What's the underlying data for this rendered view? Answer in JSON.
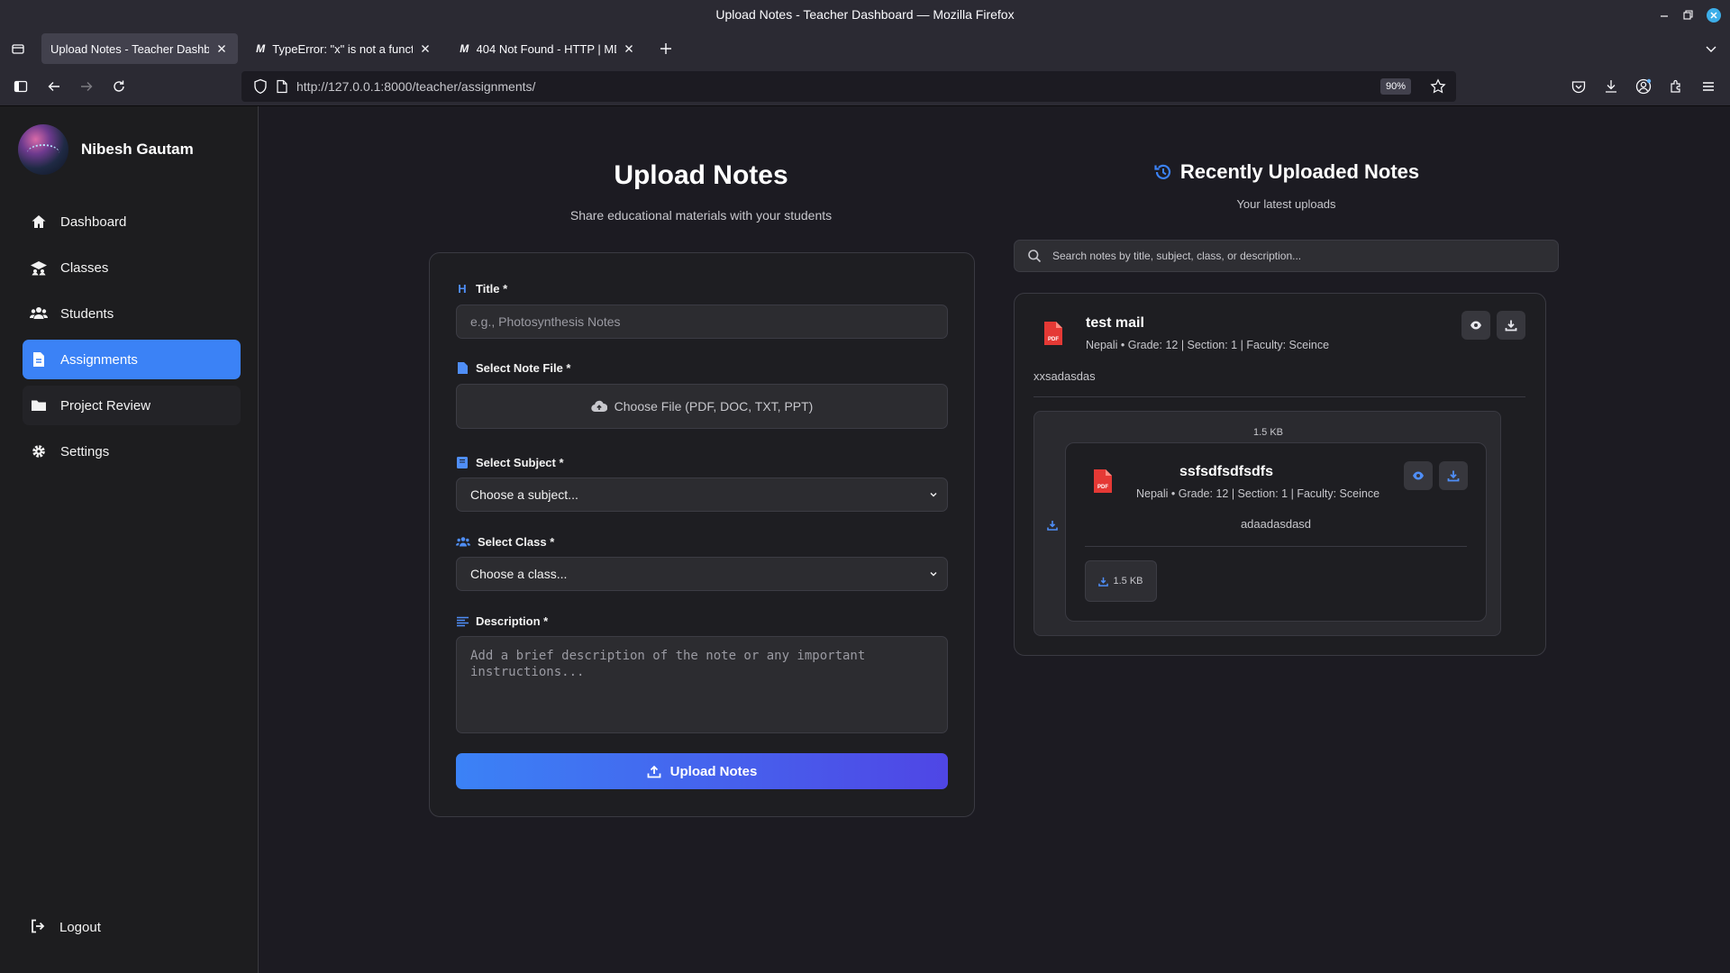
{
  "window": {
    "title": "Upload Notes - Teacher Dashboard — Mozilla Firefox"
  },
  "tabs": [
    {
      "label": "Upload Notes - Teacher Dashboard",
      "favicon": ""
    },
    {
      "label": "TypeError: \"x\" is not a function",
      "favicon": "M"
    },
    {
      "label": "404 Not Found - HTTP | MDN",
      "favicon": "M"
    }
  ],
  "address": {
    "url": "http://127.0.0.1:8000/teacher/assignments/",
    "zoom": "90%"
  },
  "sidebar": {
    "user_name": "Nibesh Gautam",
    "items": [
      {
        "label": "Dashboard",
        "icon": "home-icon"
      },
      {
        "label": "Classes",
        "icon": "classes-icon"
      },
      {
        "label": "Students",
        "icon": "students-icon"
      },
      {
        "label": "Assignments",
        "icon": "document-icon"
      },
      {
        "label": "Project Review",
        "icon": "folder-icon"
      },
      {
        "label": "Settings",
        "icon": "gear-icon"
      }
    ],
    "logout": "Logout"
  },
  "upload": {
    "heading": "Upload Notes",
    "subheading": "Share educational materials with your students",
    "title_label": "Title *",
    "title_placeholder": "e.g., Photosynthesis Notes",
    "file_label": "Select Note File *",
    "file_button": "Choose File (PDF, DOC, TXT, PPT)",
    "subject_label": "Select Subject *",
    "subject_value": "Choose a subject...",
    "class_label": "Select Class *",
    "class_value": "Choose a class...",
    "description_label": "Description *",
    "description_placeholder": "Add a brief description of the note or any important instructions...",
    "submit": "Upload Notes"
  },
  "recent": {
    "heading": "Recently Uploaded Notes",
    "subheading": "Your latest uploads",
    "search_placeholder": "Search notes by title, subject, class, or description...",
    "note": {
      "title": "test mail",
      "meta": "Nepali • Grade: 12 | Section: 1 | Faculty: Sceince",
      "description": "xxsadasdas",
      "attachment_size": "1.5 KB",
      "nested": {
        "title": "ssfsdfsdfsdfs",
        "meta": "Nepali • Grade: 12 | Section: 1 | Faculty: Sceince",
        "description": "adaadasdasd",
        "size": "1.5 KB"
      }
    }
  },
  "colors": {
    "accent": "#3b82f6",
    "background": "#1c1b22",
    "pdf": "#e53935"
  }
}
